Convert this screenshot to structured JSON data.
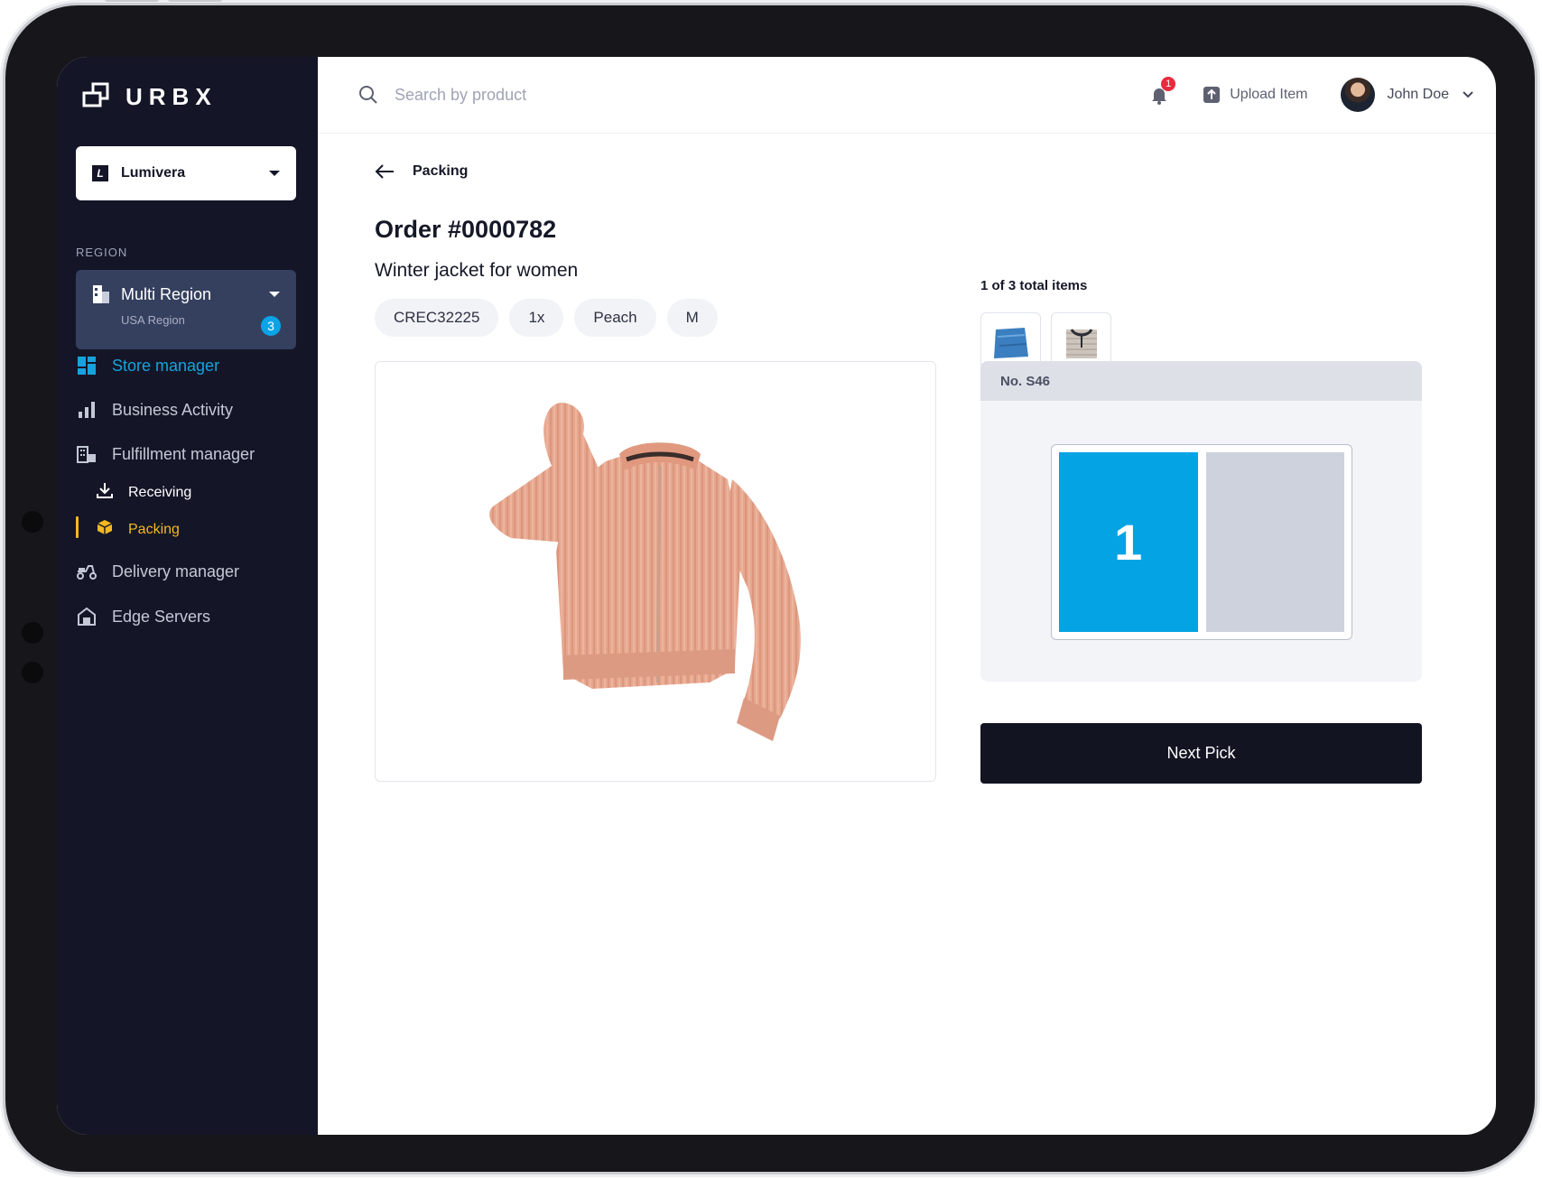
{
  "app": {
    "logo_text": "URBX"
  },
  "sidebar": {
    "store_select": {
      "badge": "L",
      "label": "Lumivera"
    },
    "region_label": "REGION",
    "region": {
      "title": "Multi Region",
      "subtitle": "USA Region",
      "count": "3"
    },
    "nav": [
      {
        "label": "Store manager",
        "icon": "store-grid-icon",
        "active": true
      },
      {
        "label": "Business Activity",
        "icon": "bar-chart-icon"
      },
      {
        "label": "Fulfillment manager",
        "icon": "building-icon"
      },
      {
        "label": "Receiving",
        "icon": "download-icon",
        "sub": true
      },
      {
        "label": "Packing",
        "icon": "box-icon",
        "sub": true,
        "active": true
      },
      {
        "label": "Delivery manager",
        "icon": "scooter-icon"
      },
      {
        "label": "Edge Servers",
        "icon": "server-house-icon"
      }
    ],
    "colors": {
      "background": "#141627",
      "accent": "#16a3dd",
      "active_sub": "#f5b81f"
    }
  },
  "topbar": {
    "search_placeholder": "Search by product",
    "notification_count": "1",
    "upload_label": "Upload Item",
    "user_name": "John Doe"
  },
  "main": {
    "back_label": "Packing",
    "order_title": "Order #0000782",
    "product_name": "Winter jacket for women",
    "chips": [
      "CREC32225",
      "1x",
      "Peach",
      "M"
    ],
    "items_count": "1 of 3 total items",
    "thumbnails": [
      "jeans-thumbnail",
      "tshirt-thumbnail"
    ],
    "box": {
      "title": "No. S46",
      "slot_label": "1"
    },
    "next_button": "Next Pick"
  },
  "colors": {
    "primary": "#04a3e3",
    "dark": "#121422",
    "product": "#e7a68e"
  }
}
